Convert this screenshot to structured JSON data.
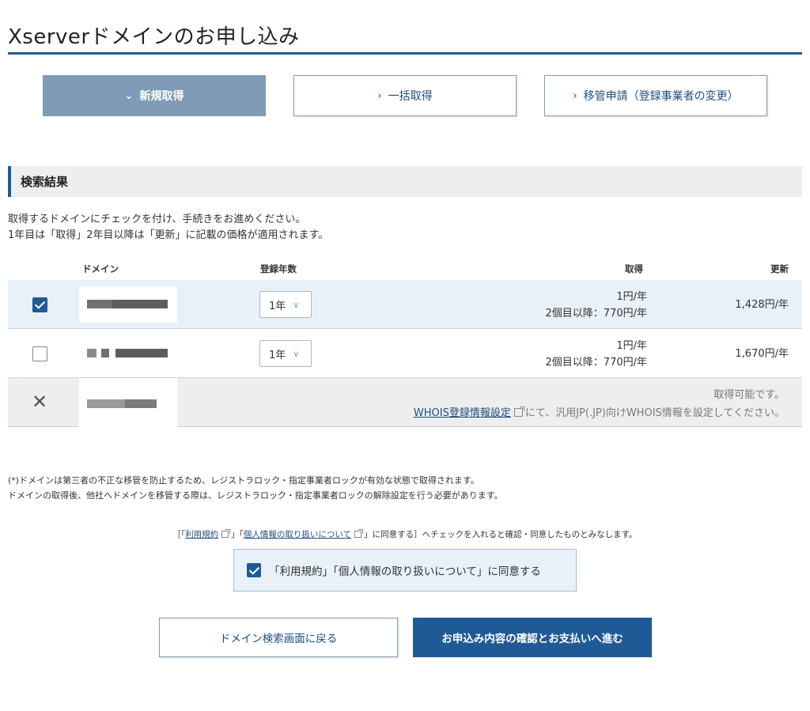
{
  "page": {
    "title": "Xserverドメインのお申し込み"
  },
  "tabs": [
    {
      "label": "新規取得",
      "active": true
    },
    {
      "label": "一括取得",
      "active": false
    },
    {
      "label": "移管申請（登録事業者の変更）",
      "active": false
    }
  ],
  "search_results": {
    "heading": "検索結果",
    "intro_line1": "取得するドメインにチェックを付け、手続きをお進めください。",
    "intro_line2": "1年目は「取得」2年目以降は「更新」に記載の価格が適用されます。",
    "columns": {
      "domain": "ドメイン",
      "years": "登録年数",
      "acquire": "取得",
      "renew": "更新"
    },
    "rows": [
      {
        "checked": true,
        "years": "1年",
        "acquire_price": "1円/年",
        "acquire_note": "2個目以降：770円/年",
        "renew_price": "1,428円/年"
      },
      {
        "checked": false,
        "years": "1年",
        "acquire_price": "1円/年",
        "acquire_note": "2個目以降：770円/年",
        "renew_price": "1,670円/年"
      },
      {
        "unavailable": true,
        "status": "取得可能です。",
        "whois_link": "WHOIS登録情報設定",
        "whois_text": "にて、汎用JP(.JP)向けWHOIS情報を設定してください。"
      }
    ]
  },
  "notes": {
    "line1": "(*)ドメインは第三者の不正な移管を防止するため、レジストラロック・指定事業者ロックが有効な状態で取得されます。",
    "line2": "ドメインの取得後、他社へドメインを移管する際は、レジストラロック・指定事業者ロックの解除設定を行う必要があります。"
  },
  "agreement": {
    "prefix": "［「",
    "terms_link": "利用規約",
    "mid": "」「",
    "privacy_link": "個人情報の取り扱いについて",
    "suffix": "」に同意する］へチェックを入れると確認・同意したものとみなします。",
    "checkbox_label": "「利用規約」「個人情報の取り扱いについて」に同意する",
    "checked": true
  },
  "buttons": {
    "back": "ドメイン検索画面に戻る",
    "next": "お申込み内容の確認とお支払いへ進む"
  },
  "colors": {
    "primary": "#1f5a96",
    "tab_active": "#7f9bb5",
    "row_selected": "#e8f0f8"
  }
}
